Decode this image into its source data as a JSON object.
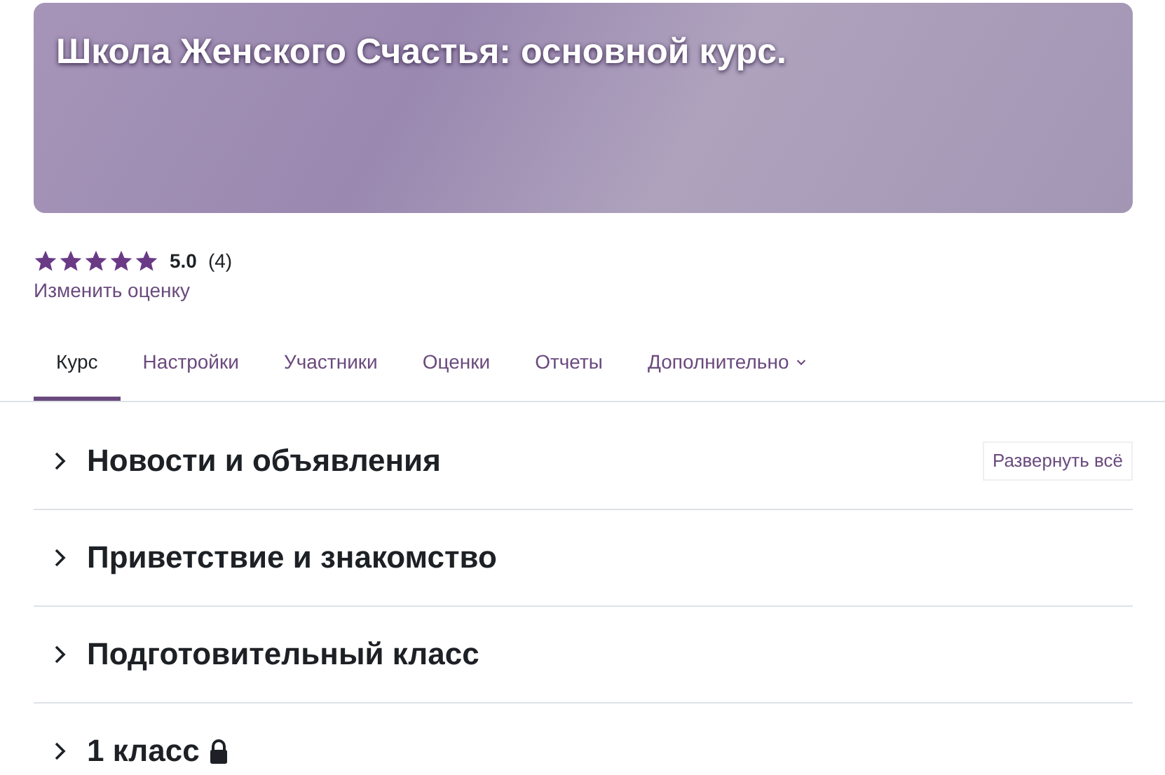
{
  "course": {
    "title": "Школа Женского Счастья: основной курс."
  },
  "rating": {
    "stars": 5,
    "score": "5.0",
    "count": "(4)",
    "change_link": "Изменить оценку"
  },
  "tabs": [
    {
      "label": "Курс",
      "selected": true
    },
    {
      "label": "Настройки",
      "selected": false
    },
    {
      "label": "Участники",
      "selected": false
    },
    {
      "label": "Оценки",
      "selected": false
    },
    {
      "label": "Отчеты",
      "selected": false
    },
    {
      "label": "Дополнительно",
      "selected": false,
      "kind": "dropdown"
    }
  ],
  "expand_all": "Развернуть всё",
  "sections": [
    {
      "title": "Новости и объявления",
      "expanded": false,
      "locked": false
    },
    {
      "title": "Приветствие и знакомство",
      "expanded": false,
      "locked": false
    },
    {
      "title": "Подготовительный класс",
      "expanded": false,
      "locked": false
    },
    {
      "title": "1 класс",
      "expanded": false,
      "locked": true
    }
  ]
}
